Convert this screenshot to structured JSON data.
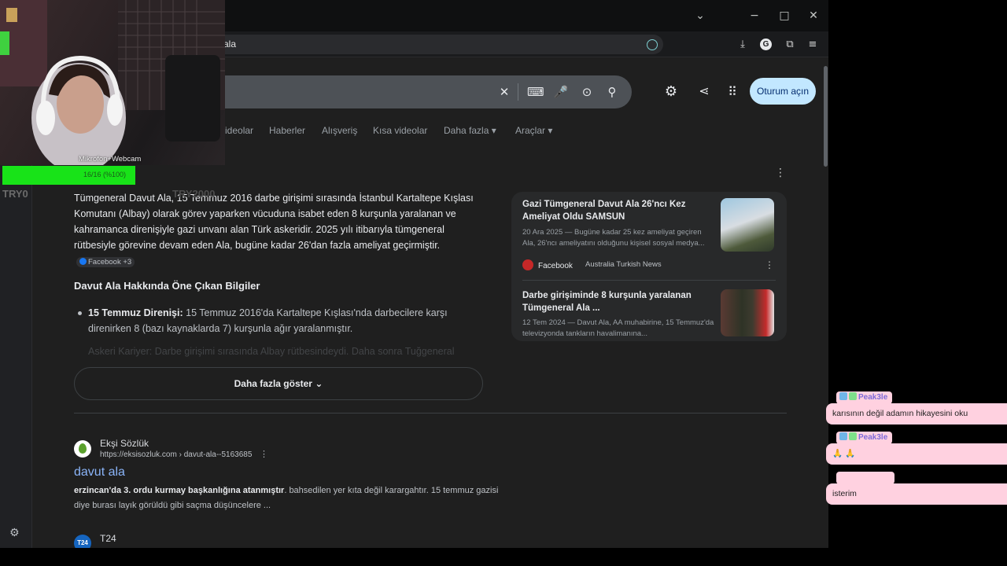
{
  "browser": {
    "url": "ala",
    "window_controls": {
      "dropdown": "⌄",
      "minimize": "−",
      "maximize": "□",
      "close": "✕"
    }
  },
  "search": {
    "clear_icon": "✕",
    "keyboard_icon": "⌨",
    "mic_icon": "🎤",
    "lens_icon": "⊙",
    "search_icon": "⚲"
  },
  "header": {
    "signin_label": "Oturum açın"
  },
  "nav": {
    "tabs": [
      "ideolar",
      "Haberler",
      "Alışveriş",
      "Kısa videolar",
      "Daha fazla ▾",
      "Araçlar ▾"
    ]
  },
  "ai_overview": {
    "paragraph": "Tümgeneral Davut Ala, 15 Temmuz 2016 darbe girişimi sırasında İstanbul Kartaltepe Kışlası Komutanı (Albay) olarak görev yaparken vücuduna isabet eden 8 kurşunla yaralanan ve kahramanca direnişiyle gazi unvanı alan Türk askeridir. 2025 yılı itibarıyla tümgeneral rütbesiyle görevine devam eden Ala, bugüne kadar 26'dan fazla ameliyat geçirmiştir.",
    "source_chip": "Facebook +3",
    "heading": "Davut Ala Hakkında Öne Çıkan Bilgiler",
    "bullet1_bold": "15 Temmuz Direnişi:",
    "bullet1_text": " 15 Temmuz 2016'da Kartaltepe Kışlası'nda darbecilere karşı direnirken 8 (bazı kaynaklarda 7) kurşunla ağır yaralanmıştır.",
    "bullet2_faded": "Askeri Kariyer: Darbe girişimi sırasında Albay rütbesindeydi. Daha sonra Tuğgeneral",
    "show_more": "Daha fazla göster"
  },
  "sources": [
    {
      "title": "Gazi Tümgeneral Davut Ala 26'ncı Kez Ameliyat Oldu SAMSUN",
      "meta": "20 Ara 2025 — Bugüne kadar 25 kez ameliyat geçiren Ala, 26'ncı ameliyatını olduğunu kişisel sosyal medya...",
      "publisher": "Facebook",
      "sub_publisher": "Australia Turkish News"
    },
    {
      "title": "Darbe girişiminde 8 kurşunla yaralanan Tümgeneral Ala ...",
      "meta": "12 Tem 2024 — Davut Ala, AA muhabirine, 15 Temmuz'da televizyonda tankların havalimanına..."
    }
  ],
  "results": [
    {
      "site": "Ekşi Sözlük",
      "url": "https://eksisozluk.com › davut-ala--5163685",
      "title": "davut ala",
      "snippet_bold": "erzincan'da 3. ordu kurmay başkanlığına atanmıştır",
      "snippet_rest": ". bahsedilen yer kıta değil karargahtır. 15 temmuz gazisi diye burası layık görüldü gibi saçma düşüncelere ..."
    },
    {
      "site": "T24",
      "favicon_text": "T24"
    }
  ],
  "stream": {
    "webcam_label": "Mikrofon+Webcam",
    "bar_text": "16/16 (%100)",
    "left_name": "TRY0",
    "right_name": "TRY2000"
  },
  "chat": [
    {
      "user": "Peak3le",
      "message": "karısının değil adamın hikayesini oku"
    },
    {
      "user": "Peak3le",
      "message": "🙏 🙏"
    },
    {
      "user": "",
      "message": "isterim"
    }
  ],
  "colors": {
    "accent_link": "#8ab4f8",
    "signin_bg": "#c2e7ff",
    "green_bar": "#18e318",
    "chat_bg": "#ffd1e0"
  }
}
